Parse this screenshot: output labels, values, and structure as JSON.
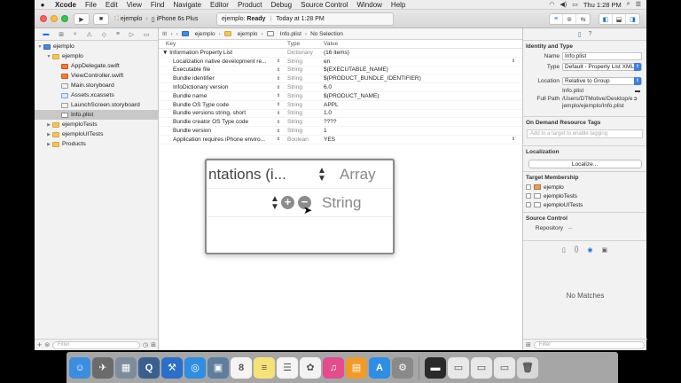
{
  "menubar": {
    "apple": "",
    "items": [
      "Xcode",
      "File",
      "Edit",
      "View",
      "Find",
      "Navigate",
      "Editor",
      "Product",
      "Debug",
      "Source Control",
      "Window",
      "Help"
    ],
    "clock": "Thu 1:28 PM"
  },
  "toolbar": {
    "scheme": "ejemplo",
    "device": "iPhone 6s Plus",
    "activity_project": "ejemplo:",
    "activity_status": "Ready",
    "activity_time": "Today at 1:28 PM"
  },
  "navigator": {
    "tree": [
      {
        "label": "ejemplo",
        "kind": "proj",
        "indent": 0,
        "tri": "▼"
      },
      {
        "label": "ejemplo",
        "kind": "folder",
        "indent": 1,
        "tri": "▼"
      },
      {
        "label": "AppDelegate.swift",
        "kind": "swift",
        "indent": 2,
        "tri": ""
      },
      {
        "label": "ViewController.swift",
        "kind": "swift",
        "indent": 2,
        "tri": ""
      },
      {
        "label": "Main.storyboard",
        "kind": "sb",
        "indent": 2,
        "tri": ""
      },
      {
        "label": "Assets.xcassets",
        "kind": "assets",
        "indent": 2,
        "tri": ""
      },
      {
        "label": "LaunchScreen.storyboard",
        "kind": "sb",
        "indent": 2,
        "tri": ""
      },
      {
        "label": "Info.plist",
        "kind": "plist",
        "indent": 2,
        "tri": "",
        "selected": true
      },
      {
        "label": "ejemploTests",
        "kind": "folder",
        "indent": 1,
        "tri": "▶"
      },
      {
        "label": "ejemploUITests",
        "kind": "folder",
        "indent": 1,
        "tri": "▶"
      },
      {
        "label": "Products",
        "kind": "folder",
        "indent": 1,
        "tri": "▶"
      }
    ],
    "filter_placeholder": "Filter"
  },
  "editor": {
    "jumpbar": {
      "project": "ejemplo",
      "group": "ejemplo",
      "file": "Info.plist",
      "selection": "No Selection"
    },
    "columns": {
      "key": "Key",
      "type": "Type",
      "value": "Value"
    },
    "rows": [
      {
        "key": "▼ Information Property List",
        "type": "Dictionary",
        "value": "(16 items)",
        "root": true
      },
      {
        "key": "Localization native development re...",
        "type": "String",
        "value": "en",
        "popup": true
      },
      {
        "key": "Executable file",
        "type": "String",
        "value": "$(EXECUTABLE_NAME)"
      },
      {
        "key": "Bundle identifier",
        "type": "String",
        "value": "$(PRODUCT_BUNDLE_IDENTIFIER)"
      },
      {
        "key": "InfoDictionary version",
        "type": "String",
        "value": "6.0"
      },
      {
        "key": "Bundle name",
        "type": "String",
        "value": "$(PRODUCT_NAME)"
      },
      {
        "key": "Bundle OS Type code",
        "type": "String",
        "value": "APPL"
      },
      {
        "key": "Bundle versions string, short",
        "type": "String",
        "value": "1.0"
      },
      {
        "key": "Bundle creator OS Type code",
        "type": "String",
        "value": "????"
      },
      {
        "key": "Bundle version",
        "type": "String",
        "value": "1"
      },
      {
        "key": "Application requires iPhone enviro...",
        "type": "Boolean",
        "value": "YES",
        "popup": true
      }
    ],
    "zoom": {
      "row1_key": "ntations (i...",
      "row1_type": "Array",
      "row2_type": "String",
      "plus": "+",
      "minus": "−"
    }
  },
  "inspector": {
    "identity_title": "Identity and Type",
    "name_label": "Name",
    "name_value": "Info.plist",
    "type_label": "Type",
    "type_value": "Default - Property List XML",
    "location_label": "Location",
    "location_value": "Relative to Group",
    "location_file": "Info.plist",
    "fullpath_label": "Full Path",
    "fullpath_value": "/Users/DTMotive/Desktop/ejemplo/ejemplo/Info.plist",
    "odr_title": "On Demand Resource Tags",
    "odr_placeholder": "Add to a target to enable tagging",
    "localization_title": "Localization",
    "localize_button": "Localize...",
    "target_title": "Target Membership",
    "targets": [
      "ejemplo",
      "ejemploTests",
      "ejemploUITests"
    ],
    "source_title": "Source Control",
    "repository_label": "Repository",
    "repository_value": "--",
    "no_matches": "No Matches",
    "filter_placeholder": "Filter"
  },
  "dock": {
    "icons": [
      {
        "name": "finder-icon",
        "color": "#3b8de0",
        "glyph": "☺"
      },
      {
        "name": "launchpad-icon",
        "color": "#6b6b6b",
        "glyph": "✈"
      },
      {
        "name": "image-viewer-icon",
        "color": "#7c8c9c",
        "glyph": "▦"
      },
      {
        "name": "quicktime-icon",
        "color": "#3a5f8f",
        "glyph": "Q"
      },
      {
        "name": "xcode-icon",
        "color": "#2a6fc9",
        "glyph": "⚒"
      },
      {
        "name": "safari-icon",
        "color": "#2f8de4",
        "glyph": "◎"
      },
      {
        "name": "preview-icon",
        "color": "#5e7e9e",
        "glyph": "▣"
      },
      {
        "name": "calendar-icon",
        "color": "#f4f4f4",
        "glyph": "8"
      },
      {
        "name": "notes-icon",
        "color": "#f7e27a",
        "glyph": "≡"
      },
      {
        "name": "reminders-icon",
        "color": "#f4f4f4",
        "glyph": "☰"
      },
      {
        "name": "photos-icon",
        "color": "#f2f2f2",
        "glyph": "✿"
      },
      {
        "name": "itunes-icon",
        "color": "#e34c8d",
        "glyph": "♫"
      },
      {
        "name": "ibooks-icon",
        "color": "#f29a29",
        "glyph": "▤"
      },
      {
        "name": "app-store-icon",
        "color": "#2d8ee6",
        "glyph": "A"
      },
      {
        "name": "system-preferences-icon",
        "color": "#8a8a8a",
        "glyph": "⚙"
      }
    ],
    "right_icons": [
      {
        "name": "activity-monitor-icon",
        "color": "#2a2a2a",
        "glyph": "▬"
      },
      {
        "name": "window-thumb-icon",
        "color": "#e8e8e8",
        "glyph": "▭"
      },
      {
        "name": "window-thumb-icon",
        "color": "#e8e8e8",
        "glyph": "▭"
      },
      {
        "name": "window-thumb-icon",
        "color": "#e8e8e8",
        "glyph": "▭"
      },
      {
        "name": "trash-icon",
        "color": "#d8d8d8",
        "glyph": "🗑"
      }
    ]
  }
}
